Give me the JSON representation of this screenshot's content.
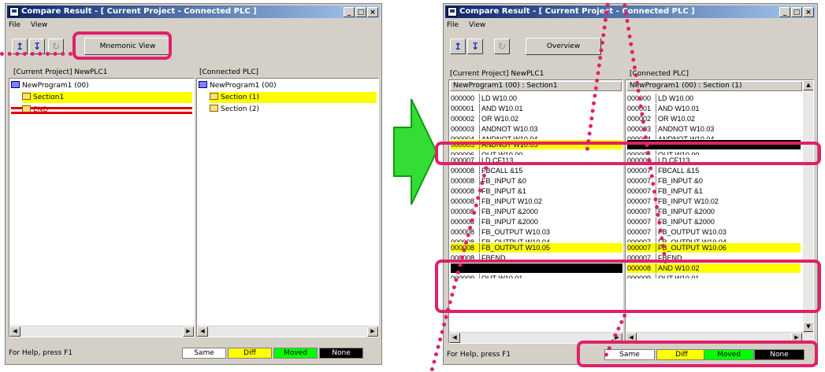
{
  "left_window": {
    "title": "Compare Result - [ Current Project  -  Connected PLC ]",
    "menu": [
      "File",
      "View"
    ],
    "mode_button": "Mnemonic View",
    "left_label": "[Current Project] NewPLC1",
    "right_label": "[Connected PLC]",
    "left_tree": [
      "NewProgram1 (00)",
      "Section1",
      "END"
    ],
    "right_tree": [
      "NewProgram1 (00)",
      "Section (1)",
      "Section (2)"
    ],
    "status": "For Help, press F1"
  },
  "right_window": {
    "title": "Compare Result - [ Current Project  -  Connected PLC ]",
    "menu": [
      "File",
      "View"
    ],
    "mode_button": "Overview",
    "left_label": "[Current Project] NewPLC1",
    "right_label": "[Connected PLC]",
    "left_header": "NewProgram1 (00) : Section1",
    "right_header": "NewProgram1 (00) : Section (1)",
    "left_lines": [
      {
        "addr": "000000",
        "text": "LD W10.00",
        "state": "same"
      },
      {
        "addr": "000001",
        "text": "AND W10.01",
        "state": "same"
      },
      {
        "addr": "000002",
        "text": "OR W10.02",
        "state": "same"
      },
      {
        "addr": "000003",
        "text": "ANDNOT W10.03",
        "state": "same"
      },
      {
        "addr": "000004",
        "text": "ANDNOT W10.04",
        "state": "clip"
      },
      {
        "addr": "000005",
        "text": "ANDNOT W10.05",
        "state": "diff"
      },
      {
        "addr": "000006",
        "text": "OUT W10.00",
        "state": "clip"
      },
      {
        "addr": "000007",
        "text": "LD CF113",
        "state": "same"
      },
      {
        "addr": "000008",
        "text": "FBCALL &15",
        "state": "same"
      },
      {
        "addr": "000008",
        "text": "FB_INPUT &0",
        "state": "same"
      },
      {
        "addr": "000008",
        "text": "FB_INPUT &1",
        "state": "same"
      },
      {
        "addr": "000008",
        "text": "FB_INPUT W10.02",
        "state": "same"
      },
      {
        "addr": "000008",
        "text": "FB_INPUT &2000",
        "state": "same"
      },
      {
        "addr": "000008",
        "text": "FB_INPUT &2000",
        "state": "same"
      },
      {
        "addr": "000008",
        "text": "FB_OUTPUT W10.03",
        "state": "same"
      },
      {
        "addr": "000008",
        "text": "FB_OUTPUT W10.04",
        "state": "clip"
      },
      {
        "addr": "000008",
        "text": "FB_OUTPUT W10.05",
        "state": "diff"
      },
      {
        "addr": "000008",
        "text": "FBEND",
        "state": "same"
      },
      {
        "addr": "",
        "text": "",
        "state": "none"
      },
      {
        "addr": "000009",
        "text": "OUT W10.01",
        "state": "clip"
      }
    ],
    "right_lines": [
      {
        "addr": "000000",
        "text": "LD W10.00",
        "state": "same"
      },
      {
        "addr": "000001",
        "text": "AND W10.01",
        "state": "same"
      },
      {
        "addr": "000002",
        "text": "OR W10.02",
        "state": "same"
      },
      {
        "addr": "000003",
        "text": "ANDNOT W10.03",
        "state": "same"
      },
      {
        "addr": "000004",
        "text": "ANDNOT W10.04",
        "state": "clip"
      },
      {
        "addr": "",
        "text": "",
        "state": "none"
      },
      {
        "addr": "000005",
        "text": "OUT W10.00",
        "state": "clip"
      },
      {
        "addr": "000006",
        "text": "LD CF113",
        "state": "same"
      },
      {
        "addr": "000007",
        "text": "FBCALL &15",
        "state": "same"
      },
      {
        "addr": "000007",
        "text": "FB_INPUT &0",
        "state": "same"
      },
      {
        "addr": "000007",
        "text": "FB_INPUT &1",
        "state": "same"
      },
      {
        "addr": "000007",
        "text": "FB_INPUT W10.02",
        "state": "same"
      },
      {
        "addr": "000007",
        "text": "FB_INPUT &2000",
        "state": "same"
      },
      {
        "addr": "000007",
        "text": "FB_INPUT &2000",
        "state": "same"
      },
      {
        "addr": "000007",
        "text": "FB_OUTPUT W10.03",
        "state": "same"
      },
      {
        "addr": "000007",
        "text": "FB_OUTPUT W10.04",
        "state": "clip"
      },
      {
        "addr": "000007",
        "text": "FB_OUTPUT W10.06",
        "state": "diff"
      },
      {
        "addr": "000007",
        "text": "FBEND",
        "state": "same"
      },
      {
        "addr": "000008",
        "text": "AND W10.02",
        "state": "diff"
      },
      {
        "addr": "000009",
        "text": "OUT W10.01",
        "state": "clip"
      }
    ],
    "status": "For Help, press F1"
  },
  "legend": [
    {
      "label": "Same",
      "bg": "#ffffff",
      "fg": "#000000"
    },
    {
      "label": "Diff",
      "bg": "#ffff00",
      "fg": "#000000"
    },
    {
      "label": "Moved",
      "bg": "#00ff00",
      "fg": "#000000"
    },
    {
      "label": "None",
      "bg": "#000000",
      "fg": "#ffffff"
    }
  ],
  "colors": {
    "highlight": "#e0206a",
    "arrow": "#33dd33",
    "diff": "#ffff00"
  }
}
